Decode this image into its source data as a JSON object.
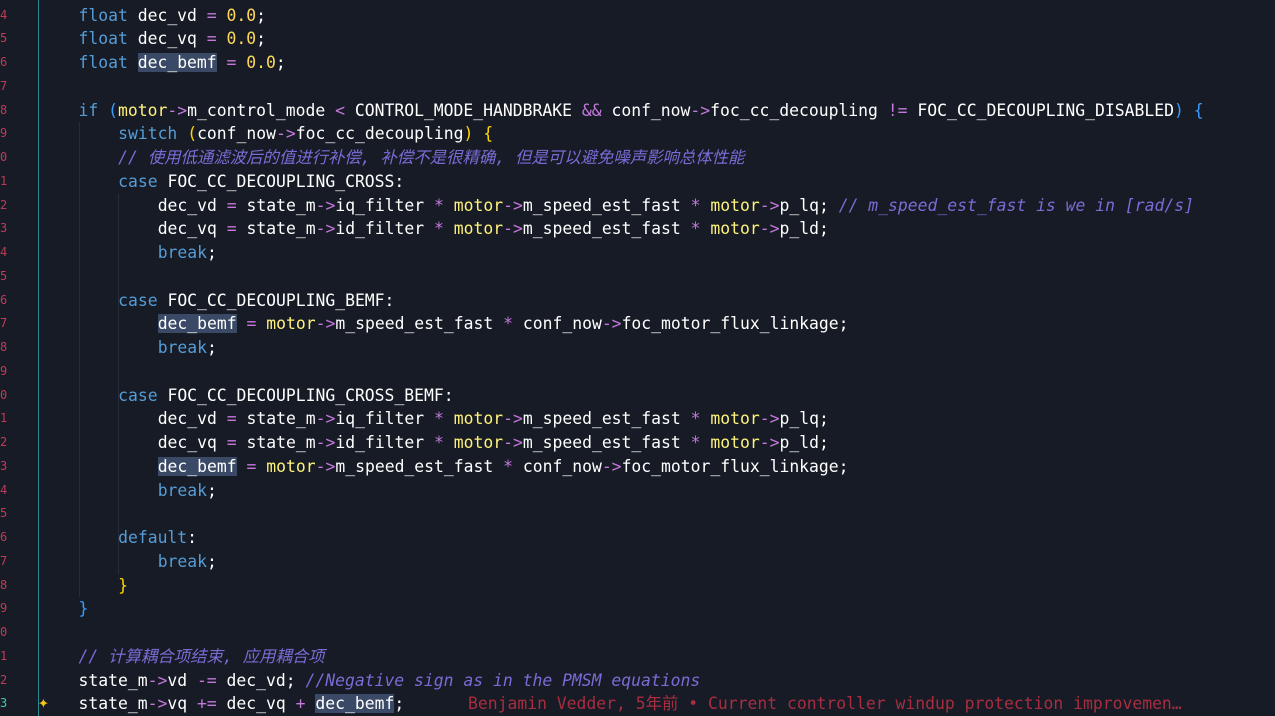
{
  "gutter": {
    "line_numbers": [
      "4",
      "5",
      "6",
      "7",
      "8",
      "9",
      "0",
      "1",
      "2",
      "3",
      "4",
      "5",
      "6",
      "7",
      "8",
      "9",
      "0",
      "1",
      "2",
      "3",
      "4",
      "5",
      "6",
      "7",
      "8",
      "9",
      "0",
      "1",
      "2",
      "3"
    ],
    "active_index": 29
  },
  "editor": {
    "lines": [
      {
        "indent": 0,
        "tokens": [
          {
            "t": "float",
            "c": "kw"
          },
          {
            "t": " dec_vd "
          },
          {
            "t": "=",
            "c": "op"
          },
          {
            "t": " "
          },
          {
            "t": "0.0",
            "c": "num"
          },
          {
            "t": ";"
          }
        ]
      },
      {
        "indent": 0,
        "tokens": [
          {
            "t": "float",
            "c": "kw"
          },
          {
            "t": " dec_vq "
          },
          {
            "t": "=",
            "c": "op"
          },
          {
            "t": " "
          },
          {
            "t": "0.0",
            "c": "num"
          },
          {
            "t": ";"
          }
        ]
      },
      {
        "indent": 0,
        "tokens": [
          {
            "t": "float",
            "c": "kw"
          },
          {
            "t": " "
          },
          {
            "t": "dec_bemf",
            "c": "hl"
          },
          {
            "t": " "
          },
          {
            "t": "=",
            "c": "op"
          },
          {
            "t": " "
          },
          {
            "t": "0.0",
            "c": "num"
          },
          {
            "t": ";"
          }
        ]
      },
      {
        "indent": 0,
        "tokens": []
      },
      {
        "indent": 0,
        "tokens": [
          {
            "t": "if",
            "c": "kw"
          },
          {
            "t": " "
          },
          {
            "t": "(",
            "c": "paren"
          },
          {
            "t": "motor",
            "c": "var"
          },
          {
            "t": "->",
            "c": "op"
          },
          {
            "t": "m_control_mode "
          },
          {
            "t": "<",
            "c": "op"
          },
          {
            "t": " CONTROL_MODE_HANDBRAKE "
          },
          {
            "t": "&&",
            "c": "op"
          },
          {
            "t": " conf_now"
          },
          {
            "t": "->",
            "c": "op"
          },
          {
            "t": "foc_cc_decoupling "
          },
          {
            "t": "!=",
            "c": "op"
          },
          {
            "t": " FOC_CC_DECOUPLING_DISABLED"
          },
          {
            "t": ")",
            "c": "paren"
          },
          {
            "t": " "
          },
          {
            "t": "{",
            "c": "paren"
          }
        ]
      },
      {
        "indent": 1,
        "tokens": [
          {
            "t": "switch",
            "c": "kw"
          },
          {
            "t": " "
          },
          {
            "t": "(",
            "c": "brace"
          },
          {
            "t": "conf_now"
          },
          {
            "t": "->",
            "c": "op"
          },
          {
            "t": "foc_cc_decoupling"
          },
          {
            "t": ")",
            "c": "brace"
          },
          {
            "t": " "
          },
          {
            "t": "{",
            "c": "brace"
          }
        ]
      },
      {
        "indent": 1,
        "tokens": [
          {
            "t": "// 使用低通滤波后的值进行补偿, 补偿不是很精确, 但是可以避免噪声影响总体性能",
            "c": "cmt"
          }
        ]
      },
      {
        "indent": 1,
        "tokens": [
          {
            "t": "case",
            "c": "kw"
          },
          {
            "t": " FOC_CC_DECOUPLING_CROSS:"
          }
        ]
      },
      {
        "indent": 2,
        "tokens": [
          {
            "t": "dec_vd "
          },
          {
            "t": "=",
            "c": "op"
          },
          {
            "t": " state_m"
          },
          {
            "t": "->",
            "c": "op"
          },
          {
            "t": "iq_filter "
          },
          {
            "t": "*",
            "c": "op"
          },
          {
            "t": " "
          },
          {
            "t": "motor",
            "c": "var"
          },
          {
            "t": "->",
            "c": "op"
          },
          {
            "t": "m_speed_est_fast "
          },
          {
            "t": "*",
            "c": "op"
          },
          {
            "t": " "
          },
          {
            "t": "motor",
            "c": "var"
          },
          {
            "t": "->",
            "c": "op"
          },
          {
            "t": "p_lq; "
          },
          {
            "t": "// m_speed_est_fast is we in [rad/s]",
            "c": "cmt"
          }
        ]
      },
      {
        "indent": 2,
        "tokens": [
          {
            "t": "dec_vq "
          },
          {
            "t": "=",
            "c": "op"
          },
          {
            "t": " state_m"
          },
          {
            "t": "->",
            "c": "op"
          },
          {
            "t": "id_filter "
          },
          {
            "t": "*",
            "c": "op"
          },
          {
            "t": " "
          },
          {
            "t": "motor",
            "c": "var"
          },
          {
            "t": "->",
            "c": "op"
          },
          {
            "t": "m_speed_est_fast "
          },
          {
            "t": "*",
            "c": "op"
          },
          {
            "t": " "
          },
          {
            "t": "motor",
            "c": "var"
          },
          {
            "t": "->",
            "c": "op"
          },
          {
            "t": "p_ld;"
          }
        ]
      },
      {
        "indent": 2,
        "tokens": [
          {
            "t": "break",
            "c": "kw"
          },
          {
            "t": ";"
          }
        ]
      },
      {
        "indent": 0,
        "tokens": []
      },
      {
        "indent": 1,
        "tokens": [
          {
            "t": "case",
            "c": "kw"
          },
          {
            "t": " FOC_CC_DECOUPLING_BEMF:"
          }
        ]
      },
      {
        "indent": 2,
        "tokens": [
          {
            "t": "dec_bemf",
            "c": "hl"
          },
          {
            "t": " "
          },
          {
            "t": "=",
            "c": "op"
          },
          {
            "t": " "
          },
          {
            "t": "motor",
            "c": "var"
          },
          {
            "t": "->",
            "c": "op"
          },
          {
            "t": "m_speed_est_fast "
          },
          {
            "t": "*",
            "c": "op"
          },
          {
            "t": " conf_now"
          },
          {
            "t": "->",
            "c": "op"
          },
          {
            "t": "foc_motor_flux_linkage;"
          }
        ]
      },
      {
        "indent": 2,
        "tokens": [
          {
            "t": "break",
            "c": "kw"
          },
          {
            "t": ";"
          }
        ]
      },
      {
        "indent": 0,
        "tokens": []
      },
      {
        "indent": 1,
        "tokens": [
          {
            "t": "case",
            "c": "kw"
          },
          {
            "t": " FOC_CC_DECOUPLING_CROSS_BEMF:"
          }
        ]
      },
      {
        "indent": 2,
        "tokens": [
          {
            "t": "dec_vd "
          },
          {
            "t": "=",
            "c": "op"
          },
          {
            "t": " state_m"
          },
          {
            "t": "->",
            "c": "op"
          },
          {
            "t": "iq_filter "
          },
          {
            "t": "*",
            "c": "op"
          },
          {
            "t": " "
          },
          {
            "t": "motor",
            "c": "var"
          },
          {
            "t": "->",
            "c": "op"
          },
          {
            "t": "m_speed_est_fast "
          },
          {
            "t": "*",
            "c": "op"
          },
          {
            "t": " "
          },
          {
            "t": "motor",
            "c": "var"
          },
          {
            "t": "->",
            "c": "op"
          },
          {
            "t": "p_lq;"
          }
        ]
      },
      {
        "indent": 2,
        "tokens": [
          {
            "t": "dec_vq "
          },
          {
            "t": "=",
            "c": "op"
          },
          {
            "t": " state_m"
          },
          {
            "t": "->",
            "c": "op"
          },
          {
            "t": "id_filter "
          },
          {
            "t": "*",
            "c": "op"
          },
          {
            "t": " "
          },
          {
            "t": "motor",
            "c": "var"
          },
          {
            "t": "->",
            "c": "op"
          },
          {
            "t": "m_speed_est_fast "
          },
          {
            "t": "*",
            "c": "op"
          },
          {
            "t": " "
          },
          {
            "t": "motor",
            "c": "var"
          },
          {
            "t": "->",
            "c": "op"
          },
          {
            "t": "p_ld;"
          }
        ]
      },
      {
        "indent": 2,
        "tokens": [
          {
            "t": "dec_bemf",
            "c": "hl"
          },
          {
            "t": " "
          },
          {
            "t": "=",
            "c": "op"
          },
          {
            "t": " "
          },
          {
            "t": "motor",
            "c": "var"
          },
          {
            "t": "->",
            "c": "op"
          },
          {
            "t": "m_speed_est_fast "
          },
          {
            "t": "*",
            "c": "op"
          },
          {
            "t": " conf_now"
          },
          {
            "t": "->",
            "c": "op"
          },
          {
            "t": "foc_motor_flux_linkage;"
          }
        ]
      },
      {
        "indent": 2,
        "tokens": [
          {
            "t": "break",
            "c": "kw"
          },
          {
            "t": ";"
          }
        ]
      },
      {
        "indent": 0,
        "tokens": []
      },
      {
        "indent": 1,
        "tokens": [
          {
            "t": "default",
            "c": "kw"
          },
          {
            "t": ":"
          }
        ]
      },
      {
        "indent": 2,
        "tokens": [
          {
            "t": "break",
            "c": "kw"
          },
          {
            "t": ";"
          }
        ]
      },
      {
        "indent": 1,
        "tokens": [
          {
            "t": "}",
            "c": "brace"
          }
        ]
      },
      {
        "indent": 0,
        "tokens": [
          {
            "t": "}",
            "c": "paren"
          }
        ]
      },
      {
        "indent": 0,
        "tokens": []
      },
      {
        "indent": 0,
        "tokens": [
          {
            "t": "// 计算耦合项结束, 应用耦合项",
            "c": "cmt"
          }
        ]
      },
      {
        "indent": 0,
        "tokens": [
          {
            "t": "state_m"
          },
          {
            "t": "->",
            "c": "op"
          },
          {
            "t": "vd "
          },
          {
            "t": "-=",
            "c": "op"
          },
          {
            "t": " dec_vd; "
          },
          {
            "t": "//Negative sign as in the PMSM equations",
            "c": "cmt"
          }
        ]
      },
      {
        "indent": 0,
        "tokens": [
          {
            "t": "state_m"
          },
          {
            "t": "->",
            "c": "op"
          },
          {
            "t": "vq "
          },
          {
            "t": "+=",
            "c": "op"
          },
          {
            "t": " dec_vq "
          },
          {
            "t": "+",
            "c": "op"
          },
          {
            "t": " "
          },
          {
            "t": "dec_bemf",
            "c": "hl"
          },
          {
            "t": ";"
          }
        ]
      }
    ]
  },
  "blame": {
    "text": "Benjamin Vedder, 5年前 • Current controller windup protection improvemen…",
    "line_index": 29
  },
  "icons": {
    "copilot_sparkle": "✦"
  },
  "colors": {
    "background": "#161b25",
    "keyword": "#569cd6",
    "highlight": "#3a4966",
    "line_number": "#c23a57"
  }
}
